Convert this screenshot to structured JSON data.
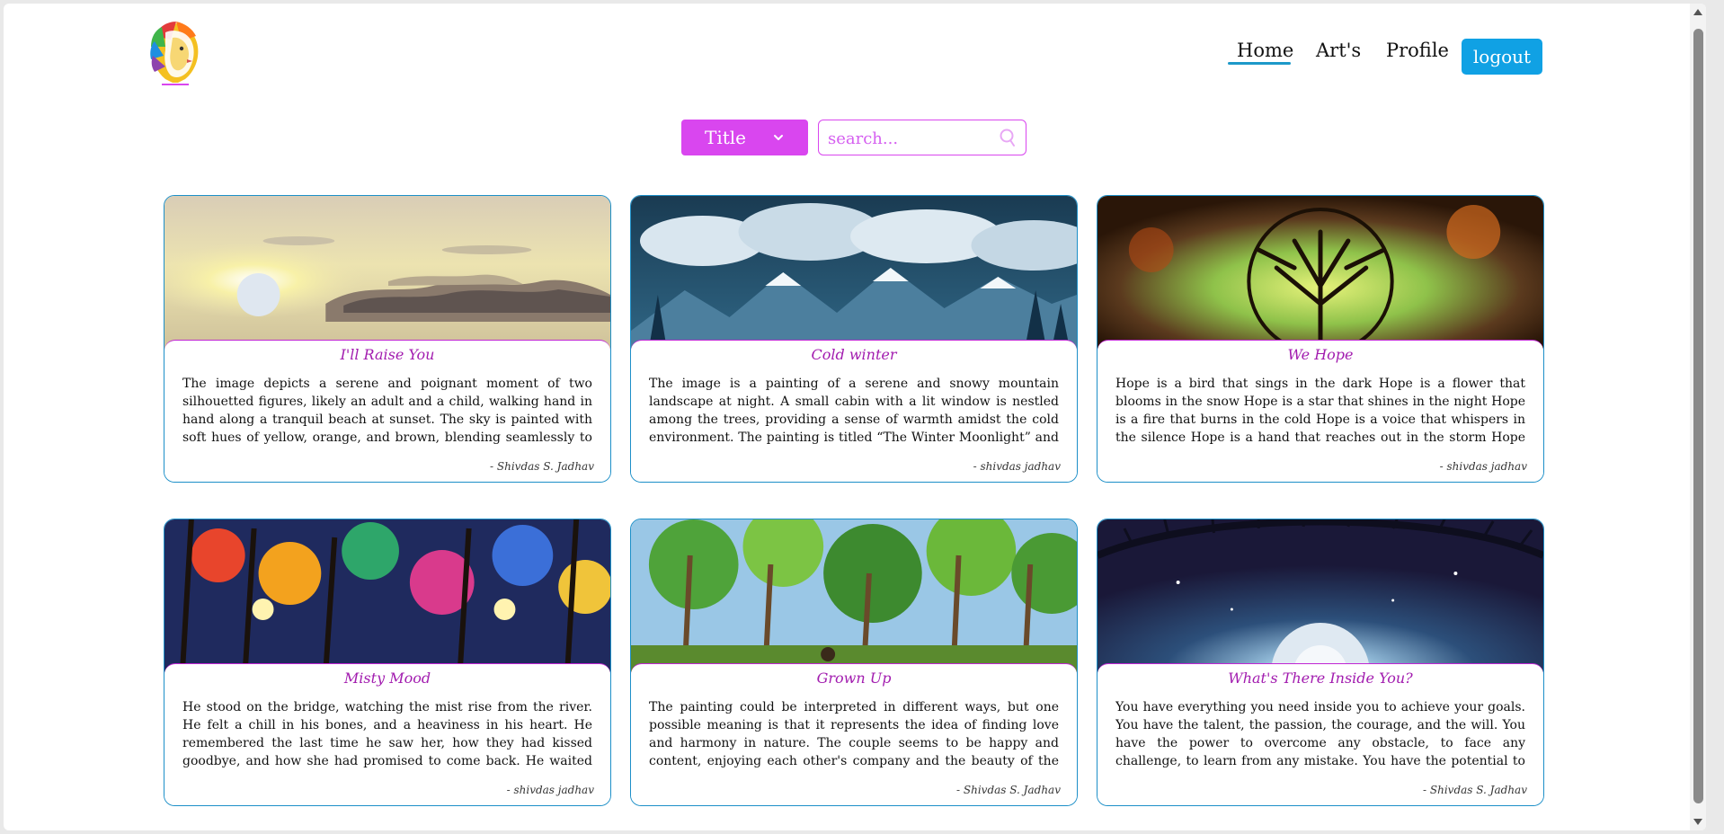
{
  "header": {
    "nav": {
      "home": "Home",
      "arts": "Art's",
      "profile": "Profile",
      "logout": "logout"
    }
  },
  "filter": {
    "select_value": "Title",
    "search_placeholder": "search..."
  },
  "cards": [
    {
      "title": "I'll Raise You",
      "text": "The image depicts a serene and poignant moment of two silhouetted figures, likely an adult and a child, walking hand in hand along a tranquil beach at sunset. The sky is painted with soft hues of yellow, orange, and brown, blending seamlessly to create a",
      "author": "- Shivdas S. Jadhav"
    },
    {
      "title": "Cold winter",
      "text": "The image is a painting of a serene and snowy mountain landscape at night. A small cabin with a lit window is nestled among the trees, providing a sense of warmth amidst the cold environment. The painting is titled “The Winter Moonlight” and was created by S.P",
      "author": "- shivdas jadhav"
    },
    {
      "title": "We Hope",
      "text": "Hope is a bird that sings in the dark Hope is a flower that blooms in the snow Hope is a star that shines in the night Hope is a fire that burns in the cold Hope is a voice that whispers in the silence Hope is a hand that reaches out in the storm Hope is a heart that beats in",
      "author": "- shivdas jadhav"
    },
    {
      "title": "Misty Mood",
      "text": "He stood on the bridge, watching the mist rise from the river. He felt a chill in his bones, and a heaviness in his heart. He remembered the last time he saw her, how they had kissed goodbye, and how she had promised to come back. He waited for her every day, hoping to",
      "author": "- shivdas jadhav"
    },
    {
      "title": "Grown Up",
      "text": "The painting could be interpreted in different ways, but one possible meaning is that it represents the idea of finding love and harmony in nature. The couple seems to be happy and content, enjoying each other's company and the beauty of the forest. They",
      "author": "- Shivdas S. Jadhav"
    },
    {
      "title": "What's There Inside You?",
      "text": "You have everything you need inside you to achieve your goals. You have the talent, the passion, the courage, and the will. You have the power to overcome any obstacle, to face any challenge, to learn from any mistake. You have the potential to grow, to improve, to excel.",
      "author": "- Shivdas S. Jadhav"
    }
  ],
  "colors": {
    "accent_pink": "#d946ef",
    "accent_blue": "#10a1e4",
    "card_border": "#1c8fc8",
    "title_purple": "#a21caf"
  }
}
